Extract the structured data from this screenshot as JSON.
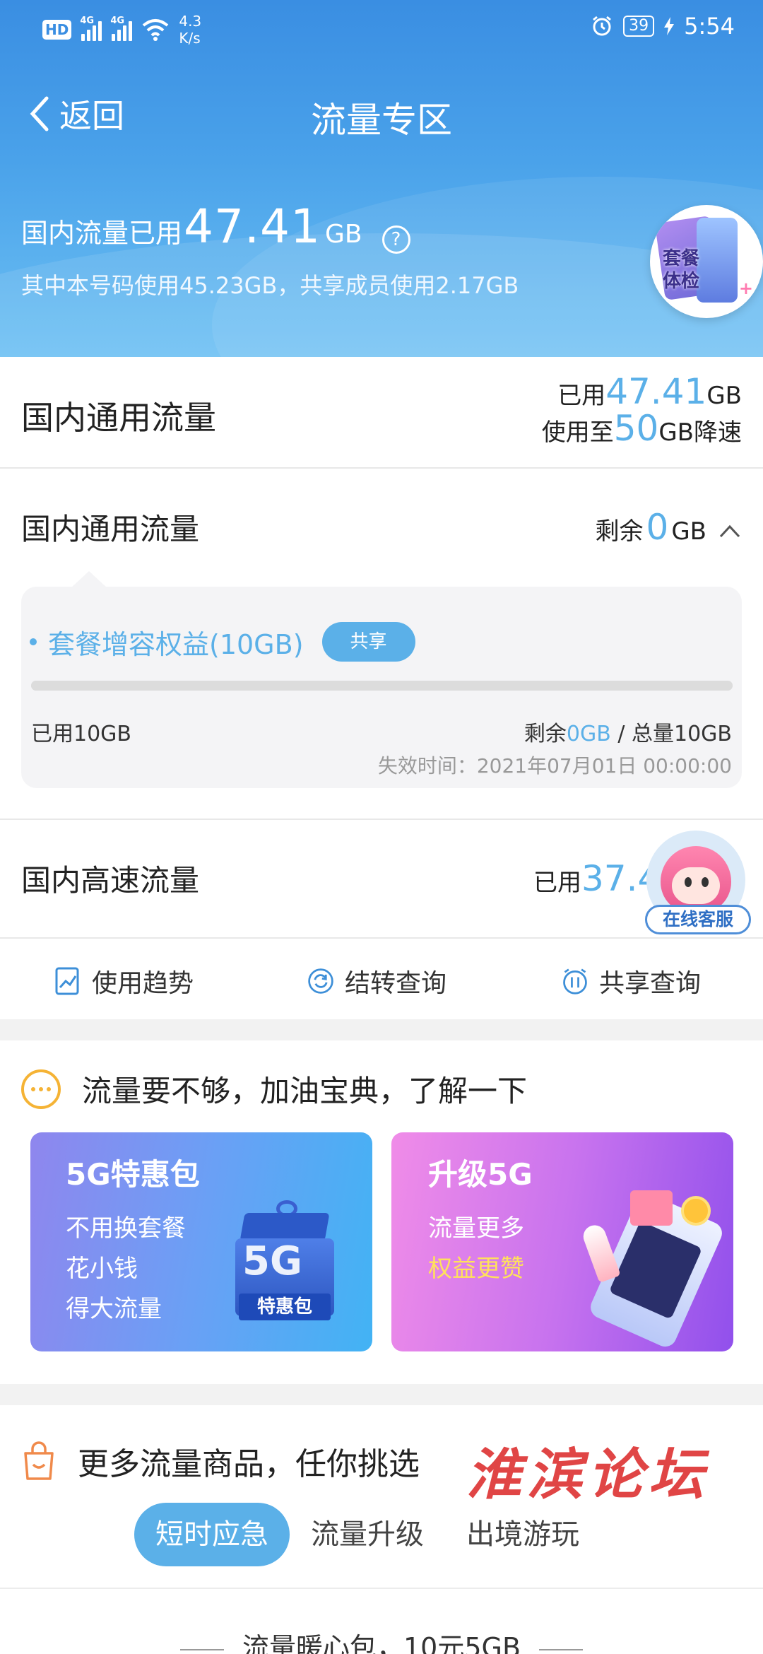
{
  "status_bar": {
    "hd": "HD",
    "sim1": "4G",
    "sim2": "4G",
    "net_speed_value": "4.3",
    "net_speed_unit": "K/s",
    "battery": "39",
    "time": "5:54"
  },
  "nav": {
    "back_label": "返回",
    "title": "流量专区"
  },
  "summary": {
    "prefix": "国内流量已用",
    "used_value": "47.41",
    "used_unit": "GB",
    "help_glyph": "?",
    "detail": "其中本号码使用45.23GB，共享成员使用2.17GB",
    "badge_line1": "套餐",
    "badge_line2": "体检"
  },
  "general": {
    "title": "国内通用流量",
    "used_prefix": "已用",
    "used_value": "47.41",
    "used_unit": "GB",
    "limit_prefix": "使用至",
    "limit_value": "50",
    "limit_suffix": "GB降速"
  },
  "pool": {
    "title": "国内通用流量",
    "remain_prefix": "剩余",
    "remain_value": "0",
    "remain_unit": "GB",
    "package": {
      "name": "套餐增容权益(10GB)",
      "badge": "共享",
      "used_fraction": 1.0,
      "used_label": "已用10GB",
      "remain_label_prefix": "剩余",
      "remain_label_value": "0GB",
      "total_label": " / 总量10GB",
      "expire": "失效时间：2021年07月01日 00:00:00"
    }
  },
  "highspeed": {
    "title": "国内高速流量",
    "used_prefix": "已用",
    "used_value_visible": "37.4"
  },
  "customer_service": {
    "label": "在线客服"
  },
  "tools": [
    {
      "label": "使用趋势",
      "icon": "trend-chart-icon"
    },
    {
      "label": "结转查询",
      "icon": "refresh-icon"
    },
    {
      "label": "共享查询",
      "icon": "share-clock-icon"
    }
  ],
  "promo": {
    "header": "流量要不够，加油宝典，了解一下",
    "card_5g": {
      "title": "5G特惠包",
      "lines": [
        "不用换套餐",
        "花小钱",
        "得大流量"
      ],
      "art_big": "5G",
      "art_label": "特惠包"
    },
    "card_upgrade": {
      "title": "升级5G",
      "line1": "流量更多",
      "line2": "权益更赞"
    }
  },
  "more": {
    "header": "更多流量商品，任你挑选",
    "watermark": "淮滨论坛",
    "tabs": [
      "短时应急",
      "流量升级",
      "出境游玩"
    ],
    "active_tab": 0,
    "first_product_title": "流量暖心包，10元5GB"
  },
  "colors": {
    "header_blue": "#3a8ee2",
    "accent_blue": "#5bb0e8",
    "promo_yellow": "#f5b335",
    "watermark_red": "#e04545"
  }
}
